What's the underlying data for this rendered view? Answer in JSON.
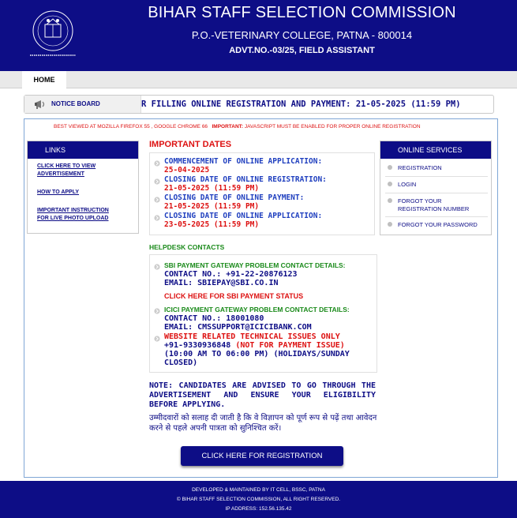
{
  "header": {
    "title": "BIHAR STAFF SELECTION COMMISSION",
    "address": "P.O.-VETERINARY COLLEGE, PATNA - 800014",
    "advt": "ADVT.NO.-03/25, FIELD ASSISTANT",
    "logo_icon": "bssc-emblem-icon"
  },
  "nav": {
    "home": "HOME"
  },
  "notice": {
    "label": "NOTICE BOARD",
    "scroll_text": "R FILLING ONLINE REGISTRATION AND PAYMENT: 21-05-2025 (11:59 PM)"
  },
  "browser_note": {
    "text": "BEST VIEWED AT MOZILLA FIREFOX 55 , GOOGLE CHROME 66",
    "important_label": "IMPORTANT:",
    "important_text": "JAVASCRIPT MUST BE ENABLED FOR PROPER ONLINE REGISTRATION"
  },
  "links": {
    "title": "LINKS",
    "items": [
      {
        "label_1": "CLICK HERE TO VIEW",
        "label_2": "ADVERTISEMENT"
      },
      {
        "label_1": "HOW TO APPLY",
        "label_2": ""
      },
      {
        "label_1": "IMPORTANT INSTRUCTION",
        "label_2": "FOR LIVE PHOTO UPLOAD"
      }
    ]
  },
  "services": {
    "title": "ONLINE SERVICES",
    "items": [
      {
        "label_1": "REGISTRATION",
        "label_2": ""
      },
      {
        "label_1": "LOGIN",
        "label_2": ""
      },
      {
        "label_1": "FORGOT YOUR",
        "label_2": "REGISTRATION NUMBER"
      },
      {
        "label_1": "FORGOT YOUR PASSWORD",
        "label_2": ""
      }
    ]
  },
  "important_dates": {
    "title": "IMPORTANT DATES",
    "items": [
      {
        "label": "COMMENCEMENT OF ONLINE APPLICATION:",
        "date": "25-04-2025"
      },
      {
        "label": "CLOSING DATE OF ONLINE REGISTRATION:",
        "date": "21-05-2025 (11:59 PM)"
      },
      {
        "label": "CLOSING DATE OF ONLINE PAYMENT:",
        "date": "21-05-2025 (11:59 PM)"
      },
      {
        "label": "CLOSING DATE OF ONLINE APPLICATION:",
        "date": "23-05-2025 (11:59 PM)"
      }
    ]
  },
  "helpdesk": {
    "title": "HELPDESK CONTACTS",
    "sbi_title": "SBI PAYMENT GATEWAY PROBLEM CONTACT DETAILS:",
    "sbi_contact": "CONTACT NO.: +91-22-20876123",
    "sbi_email": "EMAIL: SBIEPAY@SBI.CO.IN",
    "sbi_status_link": "CLICK HERE FOR SBI PAYMENT STATUS",
    "icici_title": "ICICI PAYMENT GATEWAY PROBLEM CONTACT DETAILS:",
    "icici_contact": "CONTACT NO.: 18001080",
    "icici_email": "EMAIL: CMSSUPPORT@ICICIBANK.COM",
    "tech_title": "WEBSITE RELATED TECHNICAL ISSUES ONLY",
    "tech_phone": "+91-9330936848",
    "tech_not_payment": " (NOT FOR PAYMENT ISSUE)",
    "tech_hours_1": "(10:00 AM TO 06:00 PM) (HOLIDAYS/SUNDAY",
    "tech_hours_2": "CLOSED)"
  },
  "note": {
    "english": "NOTE: CANDIDATES ARE ADVISED TO GO THROUGH THE ADVERTISEMENT AND ENSURE YOUR ELIGIBILITY BEFORE APPLYING.",
    "hindi": "उम्मीदवारों को सलाह दी जाती है कि वे विज्ञापन को पूर्ण रूप से पढ़ें तथा आवेदन करने से पहले अपनी पात्रता को सुनिश्चित करें।"
  },
  "register_button": "CLICK HERE FOR REGISTRATION",
  "footer": {
    "line1": "DEVELOPED & MAINTAINED BY IT CELL, BSSC, PATNA",
    "line2": "© BIHAR STAFF SELECTION COMMISSION, ALL RIGHT RESERVED.",
    "line3": "IP ADDRESS: 152.56.135.42"
  },
  "colors": {
    "brand_navy": "#0d0d86",
    "alert_red": "#dd1111",
    "helpdesk_green": "#1a8a1a",
    "date_label_blue": "#1f3fbf"
  }
}
